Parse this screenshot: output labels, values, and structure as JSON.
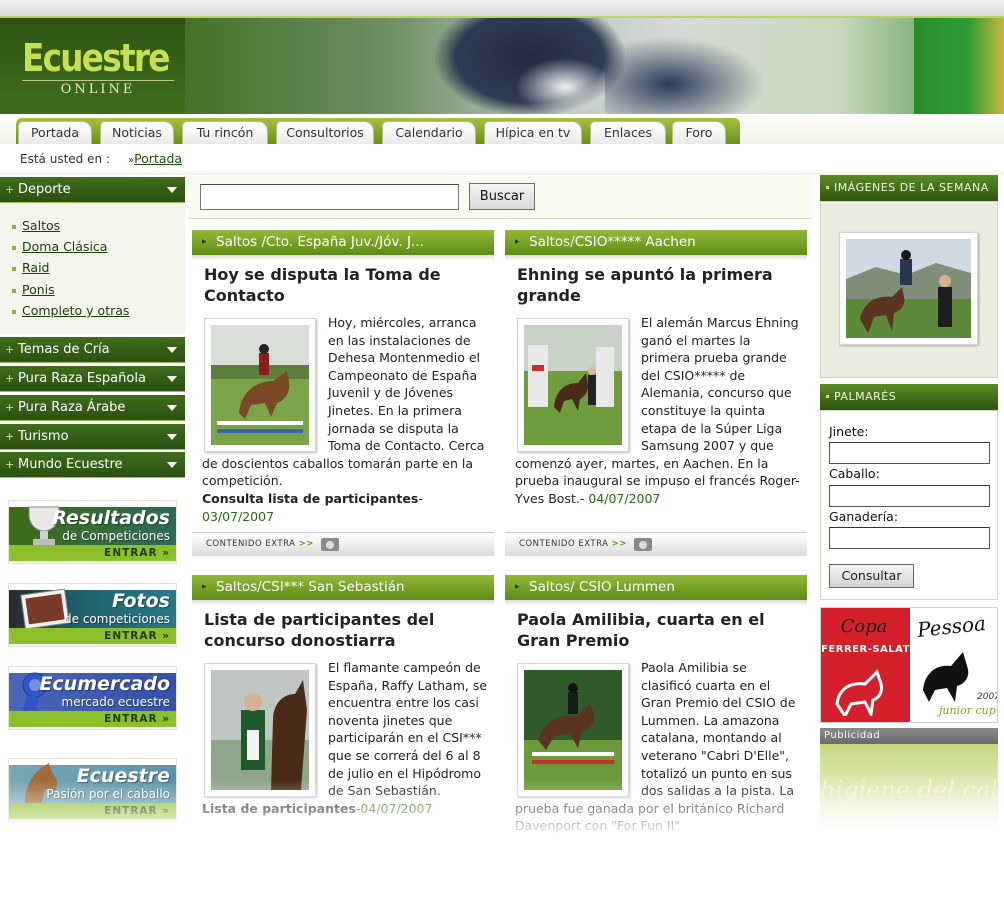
{
  "header": {
    "logo_title": "Ecuestre",
    "logo_subtitle": "ONLINE"
  },
  "nav": {
    "tabs": [
      "Portada",
      "Noticias",
      "Tu rincón",
      "Consultorios",
      "Calendario",
      "Hípica en tv",
      "Enlaces",
      "Foro"
    ]
  },
  "breadcrumb": {
    "label": "Está usted en :",
    "separator": "»",
    "current": "Portada"
  },
  "sidebar": {
    "deporte": "Deporte",
    "deporte_items": [
      "Saltos",
      "Doma Clásica",
      "Raid",
      "Ponis",
      "Completo y otras"
    ],
    "sections": [
      "Temas de Cría",
      "Pura Raza Española",
      "Pura Raza Árabe",
      "Turismo",
      "Mundo Ecuestre"
    ],
    "banners": [
      {
        "title": "Resultados",
        "subtitle": "de Competiciones",
        "enter": "ENTRAR »"
      },
      {
        "title": "Fotos",
        "subtitle": "de competiciones",
        "enter": "ENTRAR »"
      },
      {
        "title": "Ecumercado",
        "subtitle": "mercado ecuestre",
        "enter": "ENTRAR »"
      },
      {
        "title": "Ecuestre",
        "subtitle": "Pasión por el caballo",
        "enter": "ENTRAR »"
      }
    ]
  },
  "search": {
    "value": "",
    "button": "Buscar"
  },
  "articles": [
    {
      "category": "Saltos /Cto. España Juv./Jóv. J...",
      "title": "Hoy se disputa la Toma de Contacto",
      "body": "Hoy, miércoles, arranca en las instalaciones de Dehesa Montenmedio el Campeonato de España Juvenil y de Jóvenes Jinetes. En la primera jornada se disputa la Toma de Contacto. Cerca de doscientos caballos tomarán parte en la competición.",
      "link": "Consulta lista de participantes",
      "sep": "-",
      "date": "03/07/2007",
      "footer": "CONTENIDO EXTRA",
      "footer_arrow": ">>"
    },
    {
      "category": "Saltos/CSIO***** Aachen",
      "title": "Ehning se apuntó la primera grande",
      "body": "El alemán Marcus Ehning ganó el martes la primera prueba grande del CSIO***** de Alemania, concurso que constituye la quinta etapa de la Súper Liga Samsung 2007 y que comenzó ayer, martes, en Aachen. En la prueba inaugural se impuso el francés Roger-Yves Bost.",
      "link": "",
      "sep": "-",
      "date": "04/07/2007",
      "footer": "CONTENIDO EXTRA",
      "footer_arrow": ">>"
    },
    {
      "category": "Saltos/CSI*** San Sebastián",
      "title": "Lista de participantes del concurso donostiarra",
      "body": "El flamante campeón de España, Raffy Latham, se encuentra entre los casi noventa jinetes que participarán en el CSI*** que se correrá del 6 al 8 de julio en el Hipódromo de San Sebastián.",
      "link": "Lista de participantes",
      "sep": "-",
      "date": "04/07/2007",
      "footer": "",
      "footer_arrow": ""
    },
    {
      "category": "Saltos/ CSIO Lummen",
      "title": "Paola Amilibia, cuarta en el Gran Premio",
      "body": "Paola Amilibia se clasificó cuarta en el Gran Premio del CSIO de Lummen. La amazona catalana, montando al veterano \"Cabri D'Elle\", totalizó un punto en sus dos salidas a la pista. La prueba fue ganada por el británico Richard Davenport con \"For Fun II\"",
      "link": "",
      "sep": "",
      "date": "",
      "footer": "",
      "footer_arrow": ""
    }
  ],
  "right": {
    "images_title": "IMÁGENES DE LA SEMANA",
    "palmares_title": "PALMARÉS",
    "jinete_label": "Jinete:",
    "caballo_label": "Caballo:",
    "ganaderia_label": "Ganadería:",
    "consultar": "Consultar",
    "copa": {
      "copa": "Copa",
      "ferrer": "FERRER-SALAT",
      "pessoa": "Pessoa",
      "junior": "junior cup",
      "year": "2007"
    },
    "publicidad_title": "Publicidad",
    "publicidad_text": "higiene del cal"
  },
  "colors": {
    "brand_dark": "#2e5410",
    "brand_light": "#8cbf2a",
    "accent": "#c6e050"
  }
}
